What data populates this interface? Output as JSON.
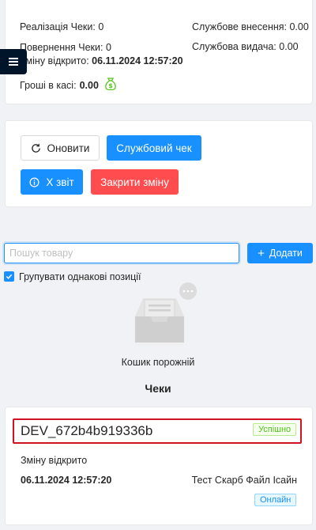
{
  "shift": {
    "sales_label": "Реалізація Чеки:",
    "sales_value": "0",
    "returns_label": "Повернення Чеки:",
    "returns_value": "0",
    "opened_label": "Зміну відкрито:",
    "opened_value": "06.11.2024 12:57:20",
    "cash_label": "Гроші в касі:",
    "cash_value": "0.00",
    "deposit_label": "Службове внесення:",
    "deposit_value": "0.00",
    "withdrawal_label": "Службова видача:",
    "withdrawal_value": "0.00"
  },
  "actions": {
    "refresh_label": "Оновити",
    "service_check_label": "Службовий чек",
    "x_report_label": "X звіт",
    "close_shift_label": "Закрити зміну"
  },
  "cart": {
    "search_placeholder": "Пошук товару",
    "add_label": "Додати",
    "group_label": "Групувати однакові позиції",
    "group_checked": true,
    "empty_text": "Кошик порожній"
  },
  "receipts": {
    "title": "Чеки",
    "items": [
      {
        "id": "DEV_672b4b919336b",
        "status": "Успішно",
        "event": "Зміну відкрито",
        "datetime": "06.11.2024 12:57:20",
        "cashier": "Тест Скарб Файл Ісайн",
        "mode": "Онлайн"
      }
    ]
  },
  "colors": {
    "primary": "#1890ff",
    "danger": "#ff4d4f",
    "success": "#52c41a",
    "highlight_border": "#cf1322",
    "sider": "#001529"
  }
}
